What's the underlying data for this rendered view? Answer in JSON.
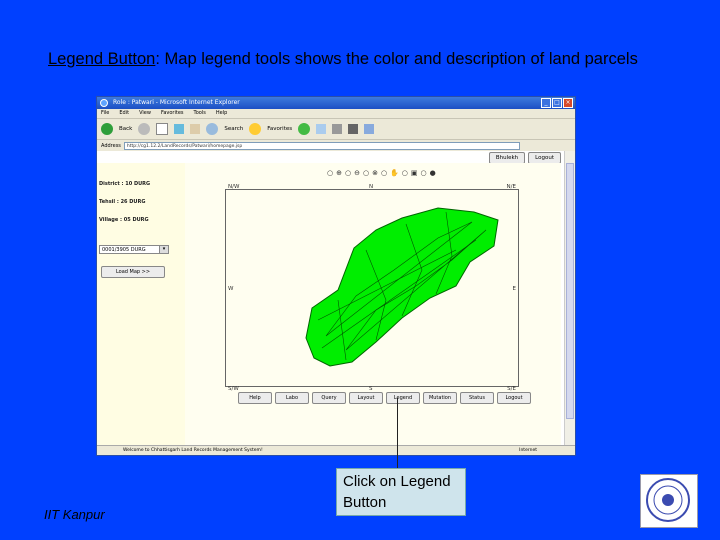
{
  "slide": {
    "title_lead": "Legend Button",
    "title_colon": ":",
    "title_rest": " Map legend tools shows the color and description of land parcels",
    "footer": "IIT Kanpur",
    "callout": "Click on Legend Button"
  },
  "browser": {
    "title": "Role : Patwari - Microsoft Internet Explorer",
    "menu": [
      "File",
      "Edit",
      "View",
      "Favorites",
      "Tools",
      "Help"
    ],
    "toolbar": {
      "back": "Back",
      "search": "Search",
      "favorites": "Favorites"
    },
    "address_label": "Address",
    "address_value": "http://cg1.12.2/LandRecords/Patwari/homepage.jsp",
    "status_text": "Welcome to Chhattisgarh Land Records Management System!",
    "status_zone": "Internet"
  },
  "app": {
    "top_buttons": [
      "Bhulekh",
      "Logout"
    ],
    "district": "District : 10 DURG",
    "tehsil": "Tehsil : 26 DURG",
    "village": "Village : 05 DURG",
    "village_select": "0001/3905 DURG",
    "load_button": "Load Map >>",
    "compass": {
      "nw": "N/W",
      "n": "N",
      "ne": "N/E",
      "w": "W",
      "e": "E",
      "sw": "S/W",
      "s": "S",
      "se": "S/E"
    },
    "map_buttons": [
      "Help",
      "Labo",
      "Query",
      "Layout",
      "Legend",
      "Mutation",
      "Status",
      "Logout"
    ]
  },
  "colors": {
    "slide_bg": "#0040ff",
    "parcel_fill": "#00ee00",
    "callout_bg": "#cfe4ec"
  }
}
